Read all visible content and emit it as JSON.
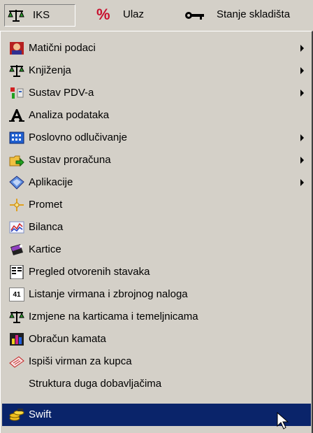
{
  "top_menu": {
    "iks_label": "IKS",
    "ulaz_label": "Ulaz",
    "stanje_label": "Stanje skladišta",
    "percent_symbol": "%"
  },
  "menu_items": [
    {
      "label": "Matični podaci",
      "icon": "person-icon",
      "submenu": true
    },
    {
      "label": "Knjiženja",
      "icon": "scales-icon",
      "submenu": true
    },
    {
      "label": "Sustav PDV-a",
      "icon": "tax-icon",
      "submenu": true
    },
    {
      "label": "Analiza podataka",
      "icon": "letter-a-icon",
      "submenu": false
    },
    {
      "label": "Poslovno odlučivanje",
      "icon": "grid-icon",
      "submenu": true
    },
    {
      "label": "Sustav proračuna",
      "icon": "folder-arrow-icon",
      "submenu": true
    },
    {
      "label": "Aplikacije",
      "icon": "puzzle-icon",
      "submenu": true
    },
    {
      "label": "Promet",
      "icon": "flow-icon",
      "submenu": false
    },
    {
      "label": "Bilanca",
      "icon": "chart-icon",
      "submenu": false
    },
    {
      "label": "Kartice",
      "icon": "card-icon",
      "submenu": false
    },
    {
      "label": "Pregled otvorenih stavaka",
      "icon": "document-icon",
      "submenu": false
    },
    {
      "label": "Listanje virmana i zbrojnog naloga",
      "icon": "calendar-icon",
      "submenu": false,
      "icon_text": "41"
    },
    {
      "label": "Izmjene na karticama i temeljnicama",
      "icon": "scales-icon",
      "submenu": false
    },
    {
      "label": "Obračun kamata",
      "icon": "bar-chart-icon",
      "submenu": false
    },
    {
      "label": "Ispiši virman za kupca",
      "icon": "print-icon",
      "submenu": false
    },
    {
      "label": "Struktura duga dobavljačima",
      "icon": "none",
      "submenu": false
    },
    {
      "label": "Swift",
      "icon": "coins-icon",
      "submenu": false,
      "selected": true
    }
  ],
  "colors": {
    "menu_bg": "#d4d0c8",
    "highlight": "#0a246a",
    "highlight_text": "#ffffff"
  }
}
